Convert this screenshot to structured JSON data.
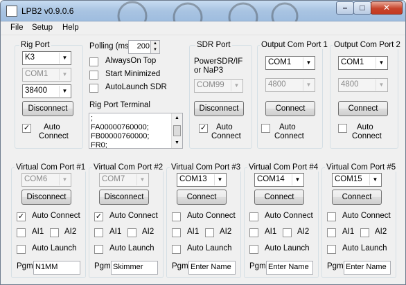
{
  "window": {
    "title": "LPB2 v0.9.0.6",
    "minimize": "–",
    "maximize": "□",
    "close": "✕"
  },
  "menu": [
    "File",
    "Setup",
    "Help"
  ],
  "rig_port": {
    "title": "Rig Port",
    "rig": "K3",
    "com": "COM1",
    "baud": "38400",
    "disconnect": "Disconnect",
    "auto_connect": "Auto Connect",
    "auto_connect_line1": "Auto",
    "auto_connect_line2": "Connect",
    "auto_connect_checked": true
  },
  "polling": {
    "label": "Polling (ms)",
    "value": "200",
    "always_on_top": "AlwaysOn Top",
    "start_minimized": "Start Minimized",
    "autolaunch_sdr": "AutoLaunch SDR",
    "terminal_label": "Rig Port Terminal",
    "terminal_lines": [
      ";",
      "FA00000760000;",
      "FB00000760000;",
      "FR0;"
    ]
  },
  "sdr_port": {
    "title": "SDR Port",
    "desc_line1": "PowerSDR/IF",
    "desc_line2": "or NaP3",
    "com": "COM99",
    "disconnect": "Disconnect",
    "auto_line1": "Auto",
    "auto_line2": "Connect",
    "auto_checked": true
  },
  "output_ports": [
    {
      "title": "Output Com Port 1",
      "com": "COM1",
      "baud": "4800",
      "button": "Connect",
      "auto_line1": "Auto",
      "auto_line2": "Connect",
      "auto_checked": false
    },
    {
      "title": "Output Com Port 2",
      "com": "COM1",
      "baud": "4800",
      "button": "Connect",
      "auto_line1": "Auto",
      "auto_line2": "Connect",
      "auto_checked": false
    }
  ],
  "virtual_ports": [
    {
      "title": "Virtual Com Port #1",
      "com": "COM6",
      "com_disabled": true,
      "button": "Disconnect",
      "auto_connect": "Auto Connect",
      "auto_checked": true,
      "ai1": "AI1",
      "ai2": "AI2",
      "auto_launch": "Auto Launch",
      "pgm_label": "Pgm",
      "pgm": "N1MM"
    },
    {
      "title": "Virtual Com Port #2",
      "com": "COM7",
      "com_disabled": true,
      "button": "Disconnect",
      "auto_connect": "Auto Connect",
      "auto_checked": true,
      "ai1": "AI1",
      "ai2": "AI2",
      "auto_launch": "Auto Launch",
      "pgm_label": "Pgm",
      "pgm": "Skimmer"
    },
    {
      "title": "Virtual Com Port #3",
      "com": "COM13",
      "com_disabled": false,
      "button": "Connect",
      "auto_connect": "Auto Connect",
      "auto_checked": false,
      "ai1": "AI1",
      "ai2": "AI2",
      "auto_launch": "Auto Launch",
      "pgm_label": "Pgm",
      "pgm": "Enter Name"
    },
    {
      "title": "Virtual Com Port #4",
      "com": "COM14",
      "com_disabled": false,
      "button": "Connect",
      "auto_connect": "Auto Connect",
      "auto_checked": false,
      "ai1": "AI1",
      "ai2": "AI2",
      "auto_launch": "Auto Launch",
      "pgm_label": "Pgm",
      "pgm": "Enter Name"
    },
    {
      "title": "Virtual Com Port #5",
      "com": "COM15",
      "com_disabled": false,
      "button": "Connect",
      "auto_connect": "Auto Connect",
      "auto_checked": false,
      "ai1": "AI1",
      "ai2": "AI2",
      "auto_launch": "Auto Launch",
      "pgm_label": "Pgm",
      "pgm": "Enter Name"
    }
  ],
  "icons": {
    "dropdown": "chevron-down-icon",
    "check": "checkmark-icon"
  }
}
